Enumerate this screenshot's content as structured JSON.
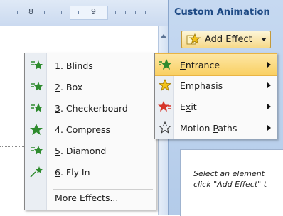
{
  "ruler": {
    "numbers": [
      "8",
      "9"
    ]
  },
  "taskpane": {
    "title": "Custom Animation",
    "add_effect_label": "Add Effect",
    "hint_line1": "Select an element",
    "hint_line2": "click \"Add Effect\" t"
  },
  "effects_menu": {
    "items": [
      {
        "num": "1",
        "name": ". Blinds"
      },
      {
        "num": "2",
        "name": ". Box"
      },
      {
        "num": "3",
        "name": ". Checkerboard"
      },
      {
        "num": "4",
        "name": ". Compress"
      },
      {
        "num": "5",
        "name": ". Diamond"
      },
      {
        "num": "6",
        "name": ". Fly In"
      }
    ],
    "more_u": "M",
    "more_rest": "ore Effects..."
  },
  "anim_menu": {
    "entrance_u": "E",
    "entrance_rest": "ntrance",
    "emphasis_a": "E",
    "emphasis_u": "m",
    "emphasis_rest": "phasis",
    "exit_a": "E",
    "exit_u": "x",
    "exit_rest": "it",
    "motion_a": "Motion ",
    "motion_u": "P",
    "motion_rest": "aths"
  },
  "colors": {
    "accent": "#f9cf62",
    "entrance_star": "#2e8b2e",
    "emphasis_star": "#e0b21a",
    "exit_star": "#d6362b"
  }
}
